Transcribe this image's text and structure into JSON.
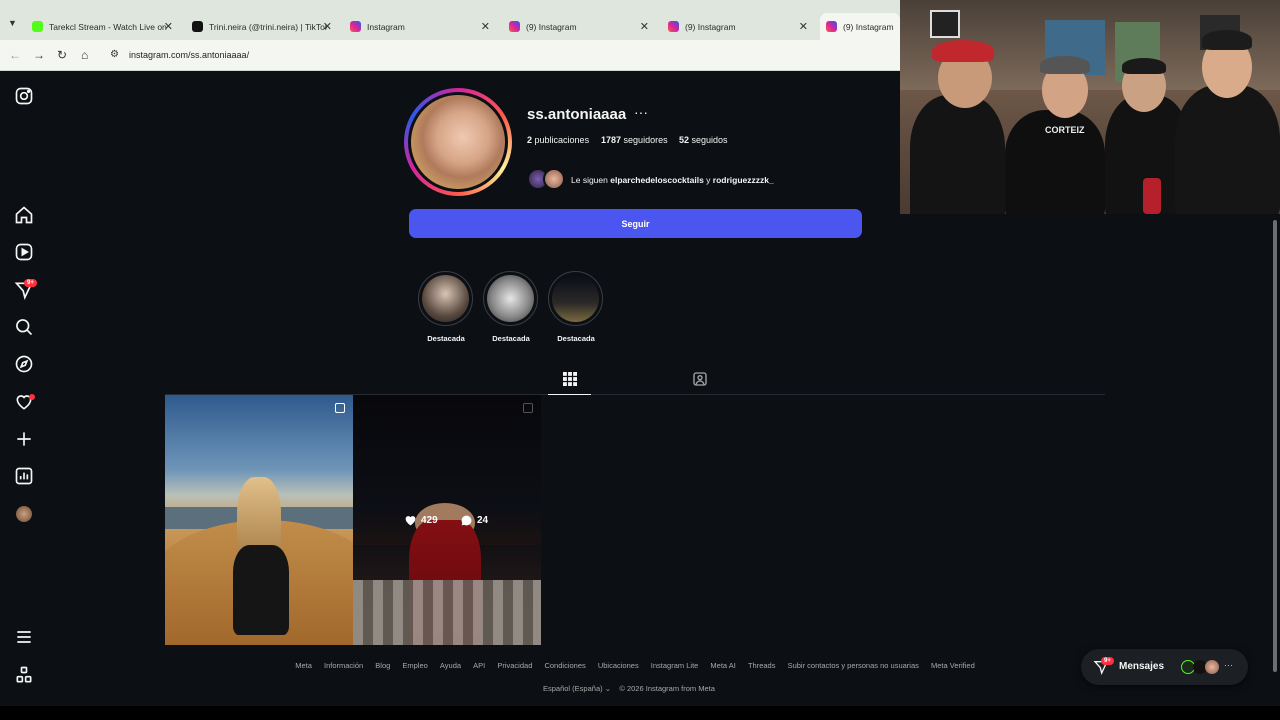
{
  "browser": {
    "tabs": [
      {
        "title": "Tarekcl Stream - Watch Live on",
        "icon": "kick-icon",
        "color": "#53fc18"
      },
      {
        "title": "Trini.neira (@trini.neira) | TikTok",
        "icon": "tiktok-icon",
        "color": "#111111"
      },
      {
        "title": "Instagram",
        "icon": "instagram-icon",
        "color": "#e1306c"
      },
      {
        "title": "(9) Instagram",
        "icon": "instagram-icon",
        "color": "#e1306c"
      },
      {
        "title": "(9) Instagram",
        "icon": "instagram-icon",
        "color": "#e1306c"
      },
      {
        "title": "(9) Instagram",
        "icon": "instagram-icon",
        "color": "#e1306c"
      }
    ],
    "url": "instagram.com/ss.antoniaaaa/"
  },
  "sidebar": {
    "notification_badge": "9+"
  },
  "profile": {
    "username": "ss.antoniaaaa",
    "more": "···",
    "posts_count": "2",
    "posts_label": "publicaciones",
    "followers_count": "1787",
    "followers_label": "seguidores",
    "following_count": "52",
    "following_label": "seguidos",
    "followed_by_prefix": "Le siguen",
    "followed_by_1": "elparchedeloscocktails",
    "followed_by_joiner": "y",
    "followed_by_2": "rodriguezzzzk_",
    "follow_button": "Seguir"
  },
  "highlights": [
    {
      "label": "Destacada"
    },
    {
      "label": "Destacada"
    },
    {
      "label": "Destacada"
    }
  ],
  "posts": [
    {
      "likes": "",
      "comments": ""
    },
    {
      "likes": "429",
      "comments": "24"
    }
  ],
  "footer": {
    "links": [
      "Meta",
      "Información",
      "Blog",
      "Empleo",
      "Ayuda",
      "API",
      "Privacidad",
      "Condiciones",
      "Ubicaciones",
      "Instagram Lite",
      "Meta AI",
      "Threads",
      "Subir contactos y personas no usuarias",
      "Meta Verified"
    ],
    "language": "Español (España)",
    "copyright": "© 2026 Instagram from Meta"
  },
  "messages": {
    "label": "Mensajes",
    "badge": "9+"
  },
  "webcam": {
    "shirt_text": "CORTEIZ"
  }
}
